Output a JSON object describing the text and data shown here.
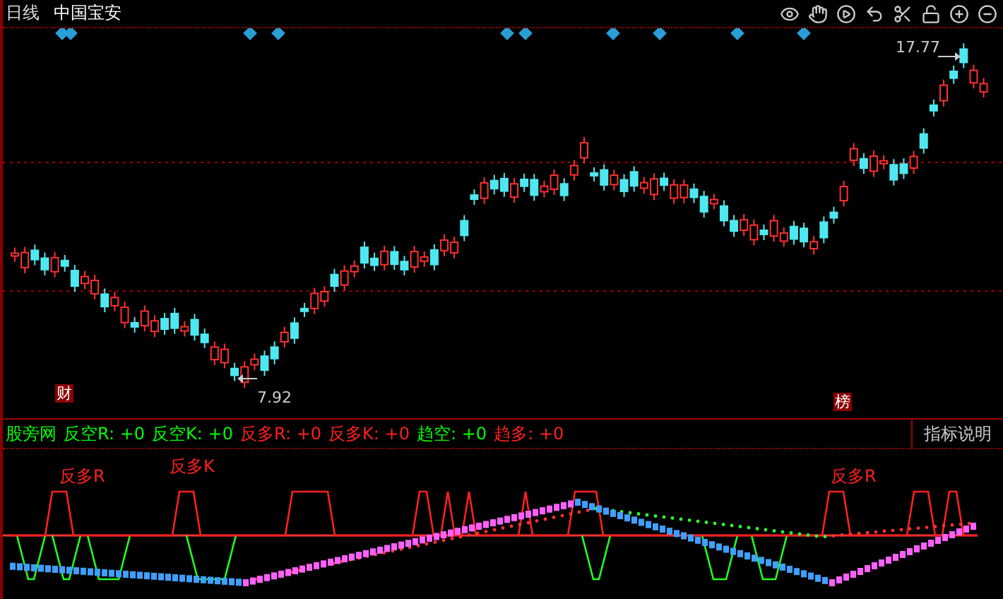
{
  "header": {
    "period": "日线",
    "stock_name": "中国宝安"
  },
  "price_labels": {
    "high": "17.77",
    "low": "7.92"
  },
  "event_markers": [
    {
      "text": "财"
    },
    {
      "text": "榜"
    }
  ],
  "indicator": {
    "name": "股旁网",
    "values": [
      {
        "label": "反空R:",
        "value": "+0",
        "color": "#00ff00"
      },
      {
        "label": "反空K:",
        "value": "+0",
        "color": "#00ff00"
      },
      {
        "label": "反多R:",
        "value": "+0",
        "color": "#ff2020"
      },
      {
        "label": "反多K:",
        "value": "+0",
        "color": "#ff2020"
      },
      {
        "label": "趋空:",
        "value": "+0",
        "color": "#00ff00"
      },
      {
        "label": "趋多:",
        "value": "+0",
        "color": "#ff2020"
      }
    ]
  },
  "help_button": "指标说明",
  "annotations": [
    {
      "text": "反多R"
    },
    {
      "text": "反多K"
    },
    {
      "text": "反多R"
    }
  ]
}
